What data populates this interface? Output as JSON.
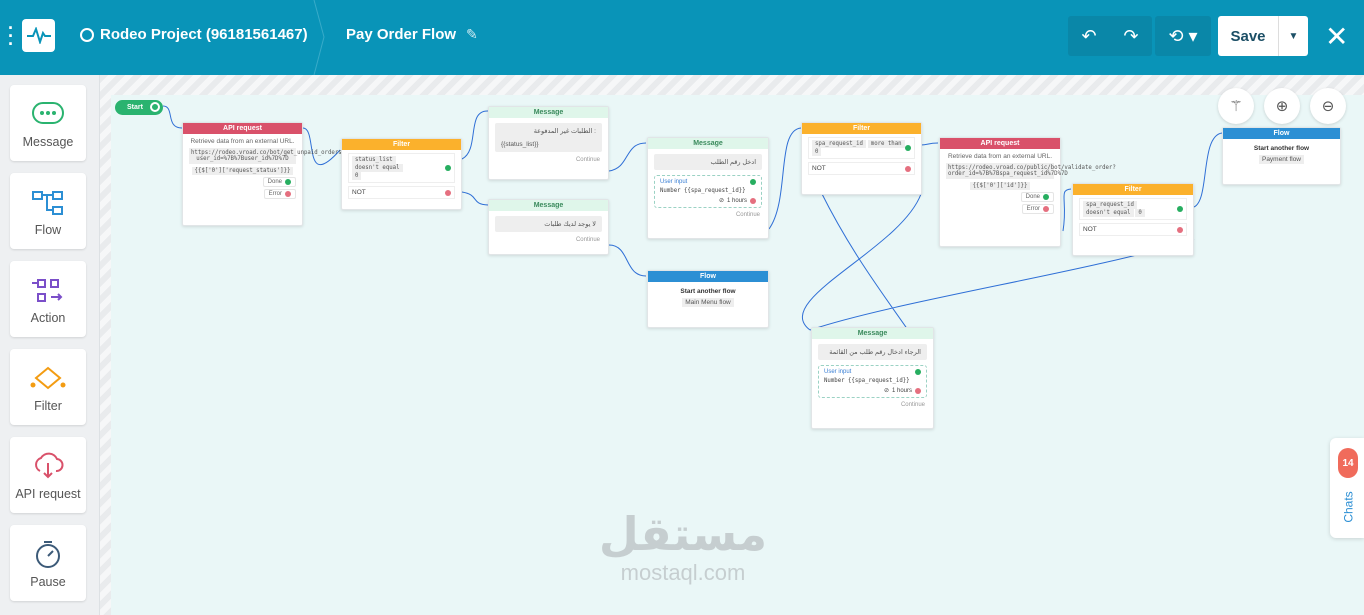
{
  "header": {
    "project": "Rodeo Project (96181561467)",
    "flow_title": "Pay Order Flow",
    "save_label": "Save"
  },
  "sidebar": {
    "items": [
      {
        "label": "Message"
      },
      {
        "label": "Flow"
      },
      {
        "label": "Action"
      },
      {
        "label": "Filter"
      },
      {
        "label": "API request"
      },
      {
        "label": "Pause"
      }
    ]
  },
  "start": {
    "label": "Start"
  },
  "nodes": {
    "api1": {
      "header": "API request",
      "desc": "Retrieve data from an external URL.",
      "url": "https://rodeo.vroad.co/bot/get_unpaid_orders?user_id=%7B%7Buser_id%7D%7D",
      "path": "{{$['0']['request_status']}}",
      "done": "Done",
      "error": "Error"
    },
    "filter1": {
      "header": "Filter",
      "field": "status_list",
      "op": "doesn't equal",
      "value": "0",
      "not": "NOT"
    },
    "msg1": {
      "header": "Message",
      "text": "الطلبات غير المدفوعة :",
      "var": "{{status_list}}",
      "continue": "Continue"
    },
    "msg2": {
      "header": "Message",
      "text": "لا يوجد لديك طلبات",
      "continue": "Continue"
    },
    "msg3": {
      "header": "Message",
      "text": "ادخل رقم الطلب",
      "input_title": "User input",
      "input_var": "Number {{spa_request_id}}",
      "timeout": "1 hours",
      "continue": "Continue"
    },
    "flow1": {
      "header": "Flow",
      "title": "Start another flow",
      "target": "Main Menu flow"
    },
    "filter2": {
      "header": "Filter",
      "field": "spa_request_id",
      "op": "more than",
      "value": "0",
      "not": "NOT"
    },
    "msg4": {
      "header": "Message",
      "text": "الرجاء ادخال رقم طلب من القائمة",
      "input_title": "User input",
      "input_var": "Number {{spa_request_id}}",
      "timeout": "1 hours",
      "continue": "Continue"
    },
    "api2": {
      "header": "API request",
      "desc": "Retrieve data from an external URL.",
      "url": "https://rodeo.vroad.co/public/bot/validate_order?order_id=%7B%7Bspa_request_id%7D%7D",
      "path": "{{$['0']['id']}}",
      "done": "Done",
      "error": "Error"
    },
    "filter3": {
      "header": "Filter",
      "field": "spa_request_id",
      "op": "doesn't equal",
      "value": "0",
      "not": "NOT"
    },
    "flow2": {
      "header": "Flow",
      "title": "Start another flow",
      "target": "Payment flow"
    }
  },
  "chats": {
    "label": "Chats",
    "count": "14"
  },
  "watermark": {
    "arabic": "مستقل",
    "latin": "mostaql.com"
  },
  "colors": {
    "topbar": "#0994b8",
    "api": "#d9516a",
    "filter": "#fbb12c",
    "message": "#dff6ea",
    "flow": "#2c8fd4",
    "link": "#2f6fd6"
  }
}
